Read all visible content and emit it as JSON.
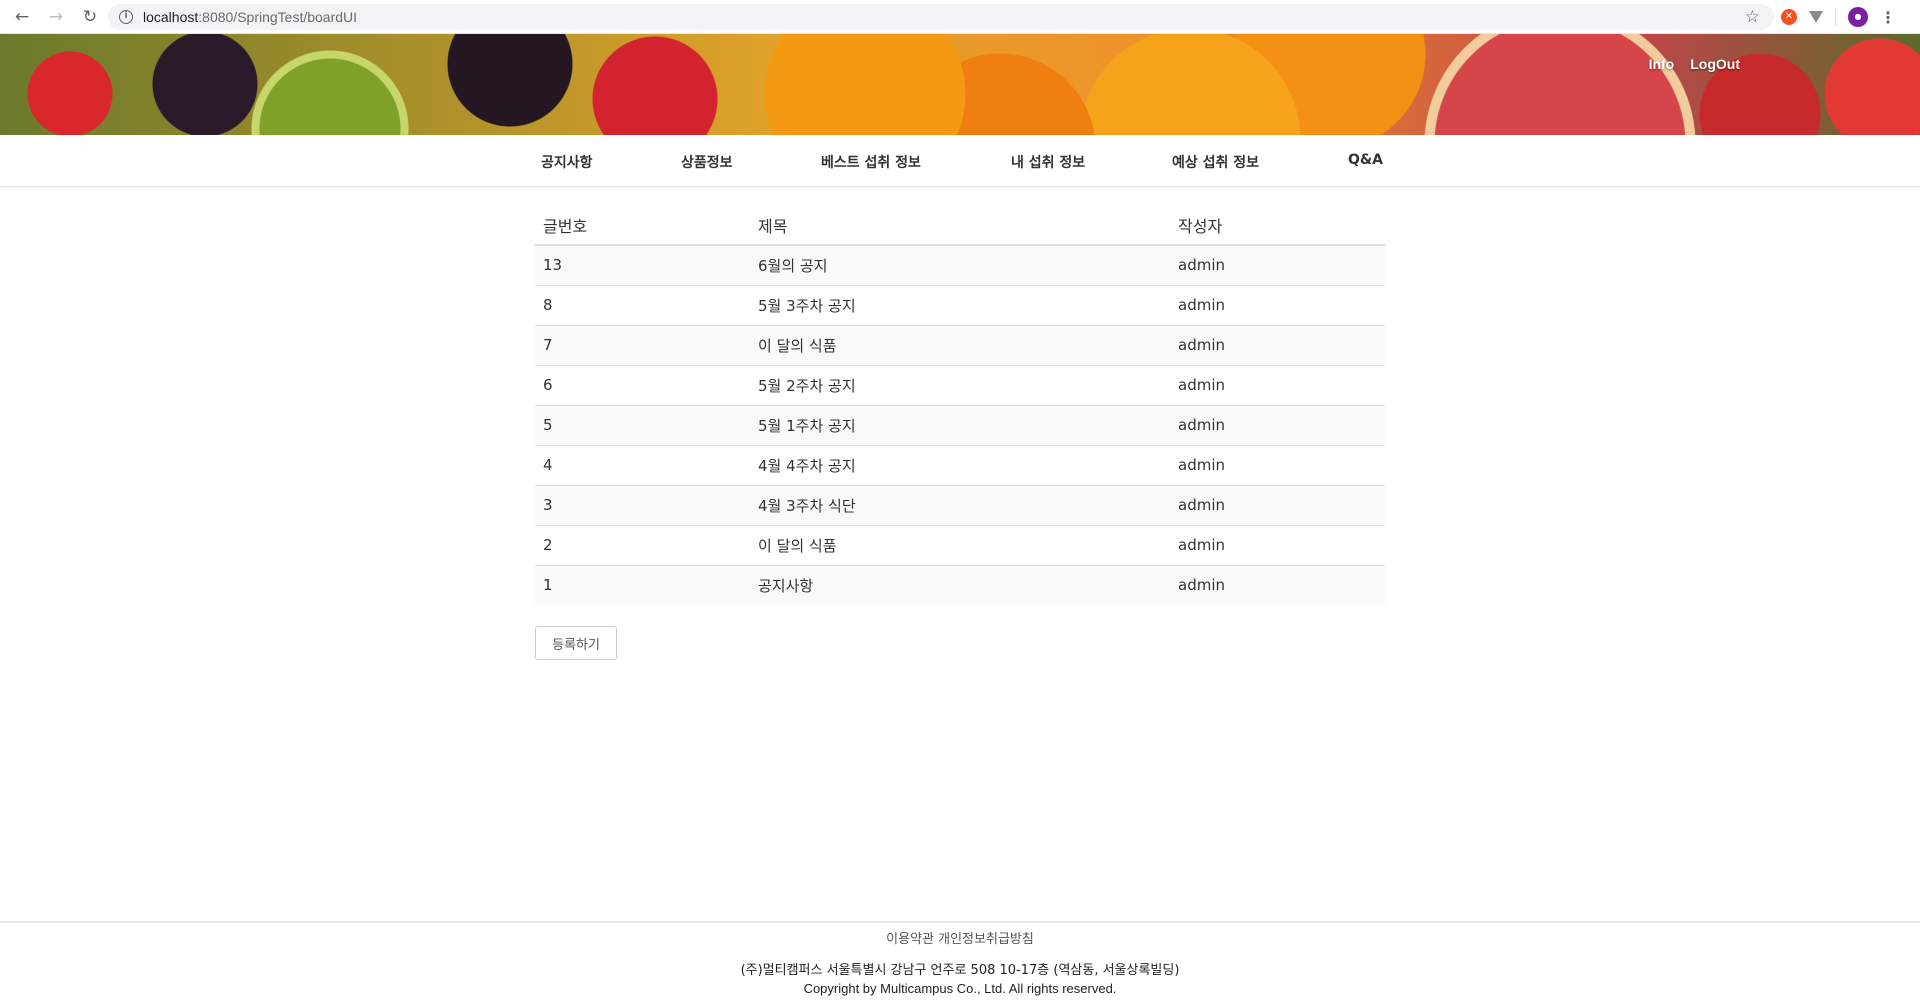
{
  "browser": {
    "url_host": "localhost",
    "url_rest": ":8080/SpringTest/boardUI"
  },
  "header": {
    "links": [
      "Info",
      "LogOut"
    ]
  },
  "nav": {
    "items": [
      "공지사항",
      "상품정보",
      "베스트 섭취 정보",
      "내 섭취 정보",
      "예상 섭취 정보",
      "Q&A"
    ]
  },
  "board": {
    "columns": [
      "글번호",
      "제목",
      "작성자"
    ],
    "rows": [
      {
        "no": "13",
        "title": "6월의 공지",
        "author": "admin"
      },
      {
        "no": "8",
        "title": "5월 3주차 공지",
        "author": "admin"
      },
      {
        "no": "7",
        "title": "이 달의 식품",
        "author": "admin"
      },
      {
        "no": "6",
        "title": "5월 2주차 공지",
        "author": "admin"
      },
      {
        "no": "5",
        "title": "5월 1주차 공지",
        "author": "admin"
      },
      {
        "no": "4",
        "title": "4월 4주차 공지",
        "author": "admin"
      },
      {
        "no": "3",
        "title": "4월 3주차 식단",
        "author": "admin"
      },
      {
        "no": "2",
        "title": "이 달의 식품",
        "author": "admin"
      },
      {
        "no": "1",
        "title": "공지사항",
        "author": "admin"
      }
    ],
    "register_label": "등록하기"
  },
  "footer": {
    "links": [
      "이용약관",
      "개인정보취급방침"
    ],
    "address": "(주)멀티캠퍼스 서울특별시 강남구 언주로 508 10-17층 (역삼동, 서울상록빌딩)",
    "copyright": "Copyright by Multicampus Co., Ltd. All rights reserved."
  },
  "icons": {
    "back": "back-arrow-icon",
    "forward": "forward-arrow-icon",
    "reload": "reload-icon",
    "info": "info-icon",
    "star": "star-icon",
    "menu": "menu-dots-icon"
  }
}
